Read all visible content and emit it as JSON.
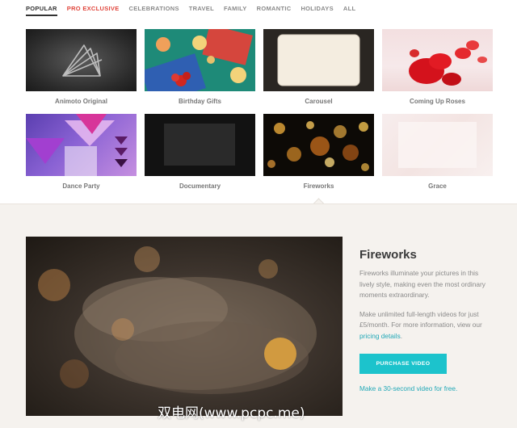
{
  "tabs": [
    {
      "label": "POPULAR",
      "state": "active"
    },
    {
      "label": "PRO EXCLUSIVE",
      "state": "pro"
    },
    {
      "label": "CELEBRATIONS",
      "state": ""
    },
    {
      "label": "TRAVEL",
      "state": ""
    },
    {
      "label": "FAMILY",
      "state": ""
    },
    {
      "label": "ROMANTIC",
      "state": ""
    },
    {
      "label": "HOLIDAYS",
      "state": ""
    },
    {
      "label": "ALL",
      "state": ""
    }
  ],
  "styles": [
    {
      "label": "Animoto Original"
    },
    {
      "label": "Birthday Gifts"
    },
    {
      "label": "Carousel"
    },
    {
      "label": "Coming Up Roses"
    },
    {
      "label": "Dance Party"
    },
    {
      "label": "Documentary"
    },
    {
      "label": "Fireworks",
      "selected": true
    },
    {
      "label": "Grace"
    }
  ],
  "detail": {
    "title": "Fireworks",
    "description": "Fireworks illuminate your pictures in this lively style, making even the most ordinary moments extraordinary.",
    "pricing_text": "Make unlimited full-length videos for just £5/month. For more information, view our",
    "pricing_link": "pricing details",
    "pricing_end": ".",
    "purchase_label": "PURCHASE VIDEO",
    "free_link": "Make a 30-second video for free."
  },
  "watermark": "双电网(www.pcpc.me)",
  "colors": {
    "accent": "#1cc3cc",
    "link": "#21a8b7",
    "pro": "#e0463c",
    "panel_bg": "#f5f2ee"
  }
}
